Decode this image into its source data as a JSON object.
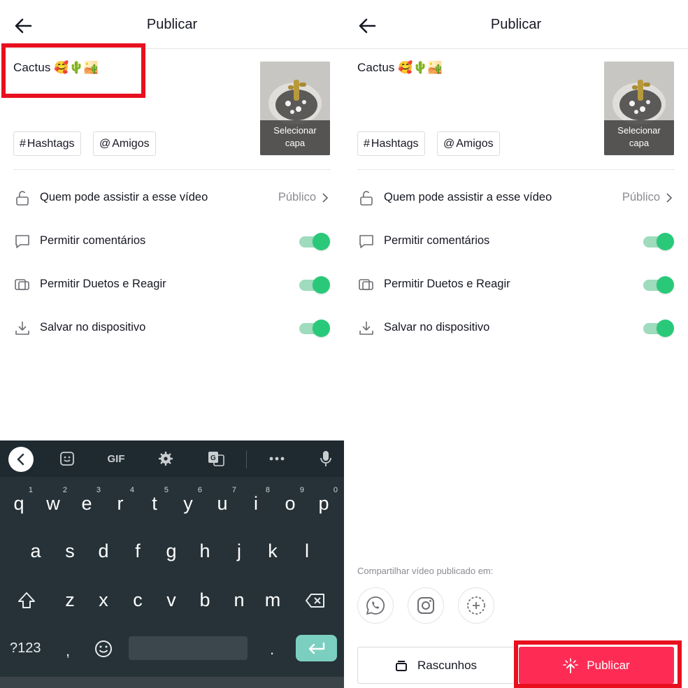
{
  "screens": [
    {
      "header": {
        "title": "Publicar"
      },
      "caption": "Cactus 🥰🌵🏜️",
      "cover": {
        "label_line1": "Selecionar",
        "label_line2": "capa"
      },
      "tags": {
        "hashtags": "Hashtags",
        "friends": "Amigos"
      },
      "settings": {
        "who_can_watch": {
          "label": "Quem pode assistir a esse vídeo",
          "value": "Público"
        },
        "comments": {
          "label": "Permitir comentários",
          "enabled": true
        },
        "duets": {
          "label": "Permitir Duetos e Reagir",
          "enabled": true
        },
        "save": {
          "label": "Salvar no dispositivo",
          "enabled": true
        }
      },
      "keyboard": {
        "toolbar": [
          "back-icon",
          "sticker-icon",
          "GIF",
          "gear-icon",
          "translate-icon",
          "more-icon",
          "mic-icon"
        ],
        "gif_label": "GIF",
        "row1": [
          "q",
          "w",
          "e",
          "r",
          "t",
          "y",
          "u",
          "i",
          "o",
          "p"
        ],
        "row1_hints": [
          "1",
          "2",
          "3",
          "4",
          "5",
          "6",
          "7",
          "8",
          "9",
          "0"
        ],
        "row2": [
          "a",
          "s",
          "d",
          "f",
          "g",
          "h",
          "j",
          "k",
          "l"
        ],
        "row3": [
          "z",
          "x",
          "c",
          "v",
          "b",
          "n",
          "m"
        ],
        "symbols_label": "?123",
        "comma": ",",
        "period": "."
      }
    },
    {
      "header": {
        "title": "Publicar"
      },
      "caption": "Cactus 🥰🌵🏜️",
      "cover": {
        "label_line1": "Selecionar",
        "label_line2": "capa"
      },
      "tags": {
        "hashtags": "Hashtags",
        "friends": "Amigos"
      },
      "settings": {
        "who_can_watch": {
          "label": "Quem pode assistir a esse vídeo",
          "value": "Público"
        },
        "comments": {
          "label": "Permitir comentários",
          "enabled": true
        },
        "duets": {
          "label": "Permitir Duetos e Reagir",
          "enabled": true
        },
        "save": {
          "label": "Salvar no dispositivo",
          "enabled": true
        }
      },
      "share": {
        "label": "Compartilhar vídeo publicado em:",
        "targets": [
          "whatsapp-icon",
          "instagram-icon",
          "add-icon"
        ]
      },
      "actions": {
        "drafts": "Rascunhos",
        "publish": "Publicar"
      }
    }
  ],
  "colors": {
    "highlight": "#e8101e",
    "publish": "#fe2c55",
    "toggle_on": "#2ac97a",
    "keyboard_bg": "#263238",
    "enter_key": "#7bcfc1"
  }
}
